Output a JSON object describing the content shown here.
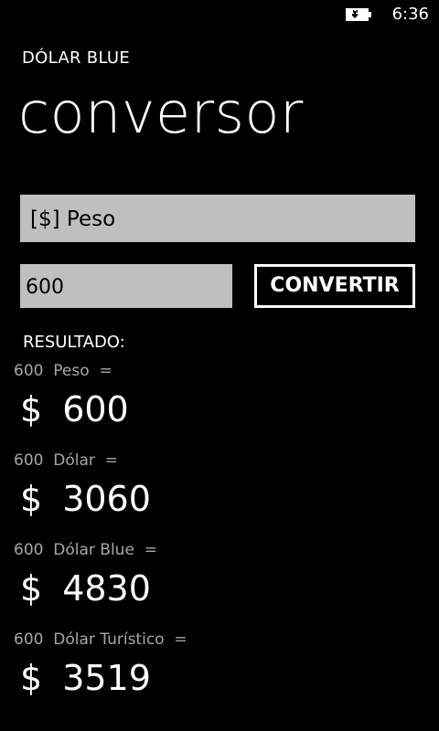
{
  "status_bar": {
    "time": "6:36",
    "battery_icon": "battery-charging-icon"
  },
  "app": {
    "title": "DÓLAR BLUE",
    "page_title": "conversor"
  },
  "form": {
    "currency_selected": "[$] Peso",
    "amount_value": "600",
    "convert_label": "CONVERTIR"
  },
  "results": {
    "label": "RESULTADO:",
    "items": [
      {
        "amount": "600",
        "currency": "Peso",
        "equals": "=",
        "symbol": "$",
        "value": "600"
      },
      {
        "amount": "600",
        "currency": "Dólar",
        "equals": "=",
        "symbol": "$",
        "value": "3060"
      },
      {
        "amount": "600",
        "currency": "Dólar Blue",
        "equals": "=",
        "symbol": "$",
        "value": "4830"
      },
      {
        "amount": "600",
        "currency": "Dólar Turístico",
        "equals": "=",
        "symbol": "$",
        "value": "3519"
      }
    ]
  },
  "colors": {
    "background": "#000000",
    "field_background": "#bfbfbf",
    "caption_text": "#a6a6a6",
    "text": "#ffffff"
  }
}
